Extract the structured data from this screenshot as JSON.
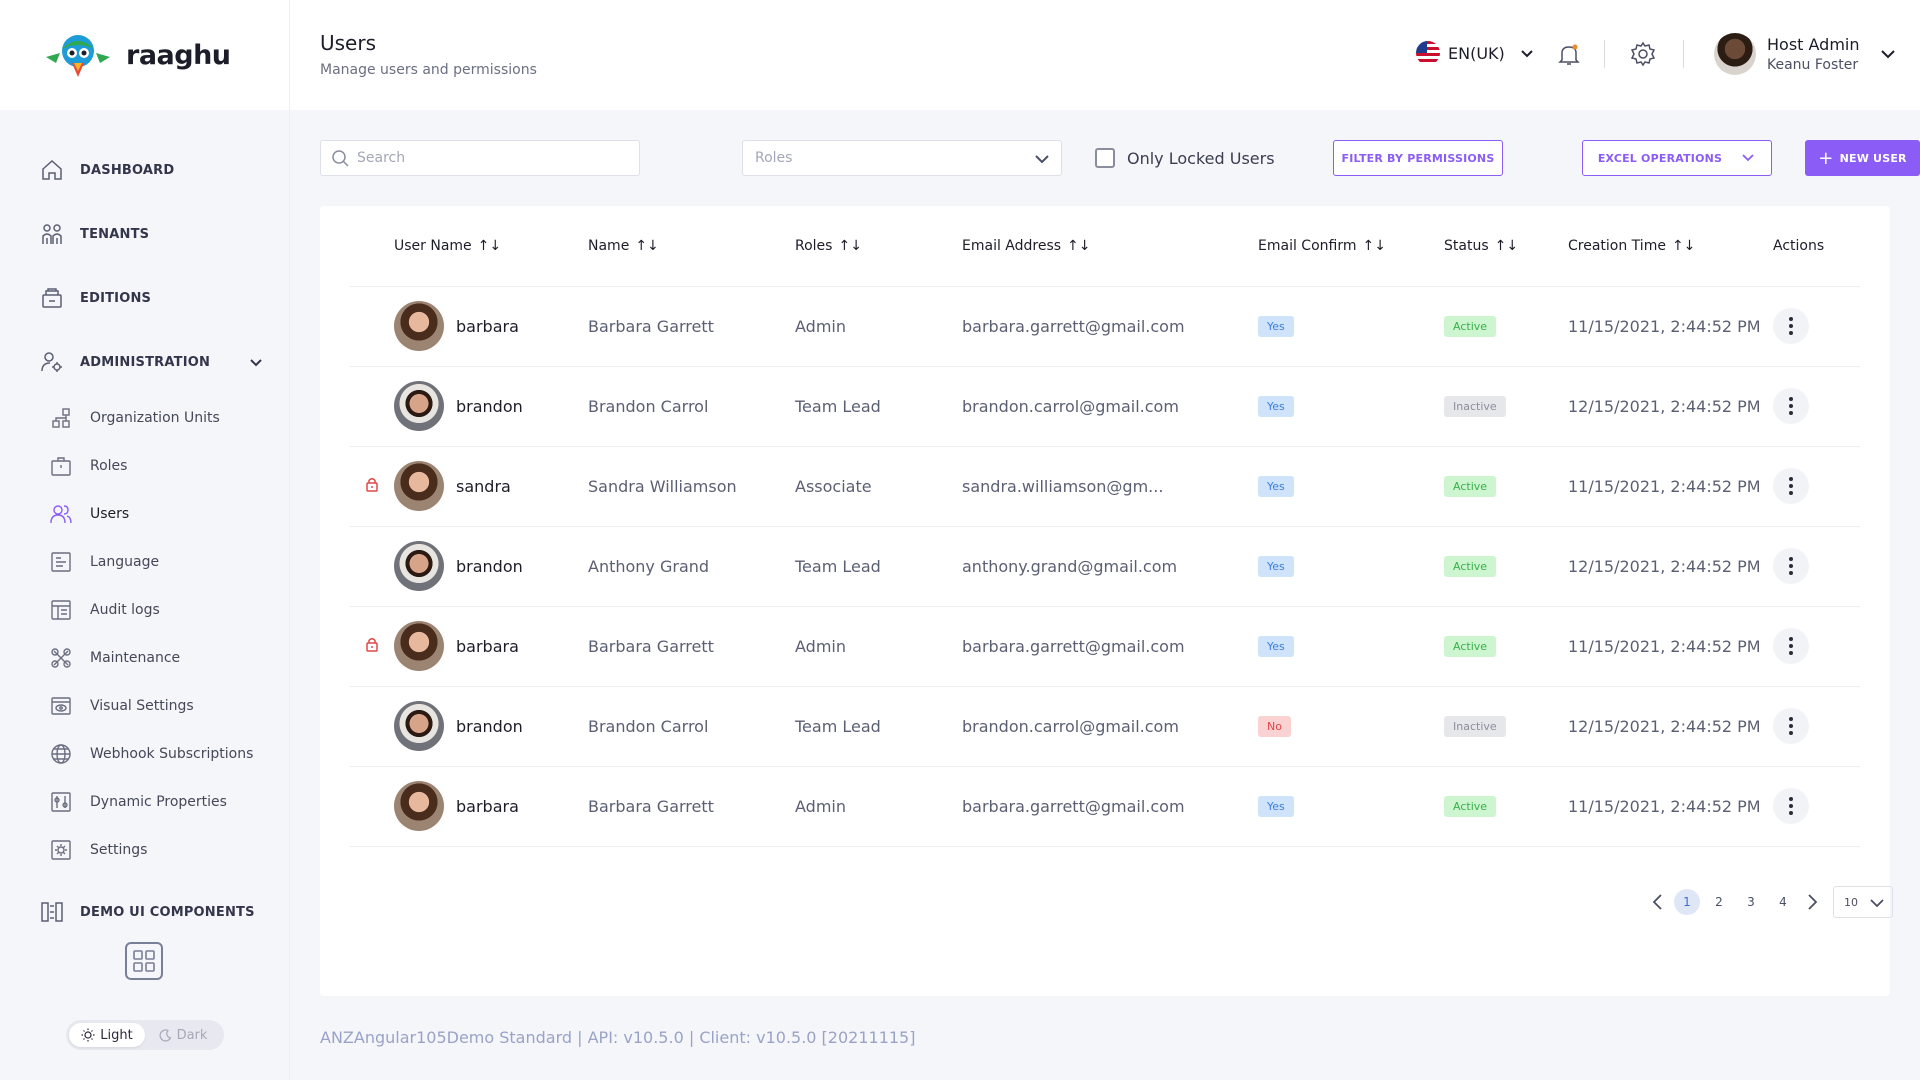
{
  "app": {
    "name": "raaghu"
  },
  "header": {
    "title": "Users",
    "subtitle": "Manage users and permissions",
    "language": "EN(UK)",
    "user": {
      "name": "Host Admin",
      "sub": "Keanu Foster"
    }
  },
  "sidebar": {
    "items": [
      {
        "label": "DASHBOARD",
        "icon": "home-icon"
      },
      {
        "label": "TENANTS",
        "icon": "tenants-icon"
      },
      {
        "label": "EDITIONS",
        "icon": "editions-icon"
      },
      {
        "label": "ADMINISTRATION",
        "icon": "administration-icon"
      }
    ],
    "admin_items": [
      {
        "label": "Organization Units",
        "icon": "org-units-icon"
      },
      {
        "label": "Roles",
        "icon": "roles-icon"
      },
      {
        "label": "Users",
        "icon": "users-icon",
        "active": true
      },
      {
        "label": "Language",
        "icon": "language-icon"
      },
      {
        "label": "Audit logs",
        "icon": "audit-logs-icon"
      },
      {
        "label": "Maintenance",
        "icon": "maintenance-icon"
      },
      {
        "label": "Visual Settings",
        "icon": "visual-settings-icon"
      },
      {
        "label": "Webhook Subscriptions",
        "icon": "webhook-icon"
      },
      {
        "label": "Dynamic Properties",
        "icon": "dynamic-properties-icon"
      },
      {
        "label": "Settings",
        "icon": "settings-icon"
      }
    ],
    "demo": "DEMO UI COMPONENTS",
    "theme": {
      "light": "Light",
      "dark": "Dark"
    }
  },
  "toolbar": {
    "search_placeholder": "Search",
    "roles_placeholder": "Roles",
    "only_locked": "Only Locked Users",
    "filter_permissions": "FILTER BY PERMISSIONS",
    "excel_operations": "EXCEL OPERATIONS",
    "new_user": "NEW USER"
  },
  "table": {
    "columns": [
      "User Name",
      "Name",
      "Roles",
      "Email Address",
      "Email Confirm",
      "Status",
      "Creation Time",
      "Actions"
    ],
    "rows": [
      {
        "locked": false,
        "avatar": "female",
        "username": "barbara",
        "name": "Barbara Garrett",
        "role": "Admin",
        "email": "barbara.garrett@gmail.com",
        "confirm": "Yes",
        "status": "Active",
        "created": "11/15/2021, 2:44:52 PM"
      },
      {
        "locked": false,
        "avatar": "male",
        "username": "brandon",
        "name": "Brandon Carrol",
        "role": "Team Lead",
        "email": "brandon.carrol@gmail.com",
        "confirm": "Yes",
        "status": "Inactive",
        "created": "12/15/2021, 2:44:52 PM"
      },
      {
        "locked": true,
        "avatar": "female",
        "username": "sandra",
        "name": "Sandra Williamson",
        "role": "Associate",
        "email": "sandra.williamson@gm...",
        "confirm": "Yes",
        "status": "Active",
        "created": "11/15/2021, 2:44:52 PM"
      },
      {
        "locked": false,
        "avatar": "male",
        "username": "brandon",
        "name": "Anthony Grand",
        "role": "Team Lead",
        "email": "anthony.grand@gmail.com",
        "confirm": "Yes",
        "status": "Active",
        "created": "12/15/2021, 2:44:52 PM"
      },
      {
        "locked": true,
        "avatar": "female",
        "username": "barbara",
        "name": "Barbara Garrett",
        "role": "Admin",
        "email": "barbara.garrett@gmail.com",
        "confirm": "Yes",
        "status": "Active",
        "created": "11/15/2021, 2:44:52 PM"
      },
      {
        "locked": false,
        "avatar": "male",
        "username": "brandon",
        "name": "Brandon Carrol",
        "role": "Team Lead",
        "email": "brandon.carrol@gmail.com",
        "confirm": "No",
        "status": "Inactive",
        "created": "12/15/2021, 2:44:52 PM"
      },
      {
        "locked": false,
        "avatar": "female",
        "username": "barbara",
        "name": "Barbara Garrett",
        "role": "Admin",
        "email": "barbara.garrett@gmail.com",
        "confirm": "Yes",
        "status": "Active",
        "created": "11/15/2021, 2:44:52 PM"
      }
    ]
  },
  "pagination": {
    "pages": [
      "1",
      "2",
      "3",
      "4"
    ],
    "current": "1",
    "page_size": "10"
  },
  "footer": {
    "text": "ANZAngular105Demo Standard | API: v10.5.0 | Client: v10.5.0 [20211115]"
  },
  "colors": {
    "accent": "#8b5cf6",
    "yes": "#3b7fe0",
    "no": "#e04848",
    "active": "#36b04a",
    "inactive": "#8b8e9c"
  }
}
